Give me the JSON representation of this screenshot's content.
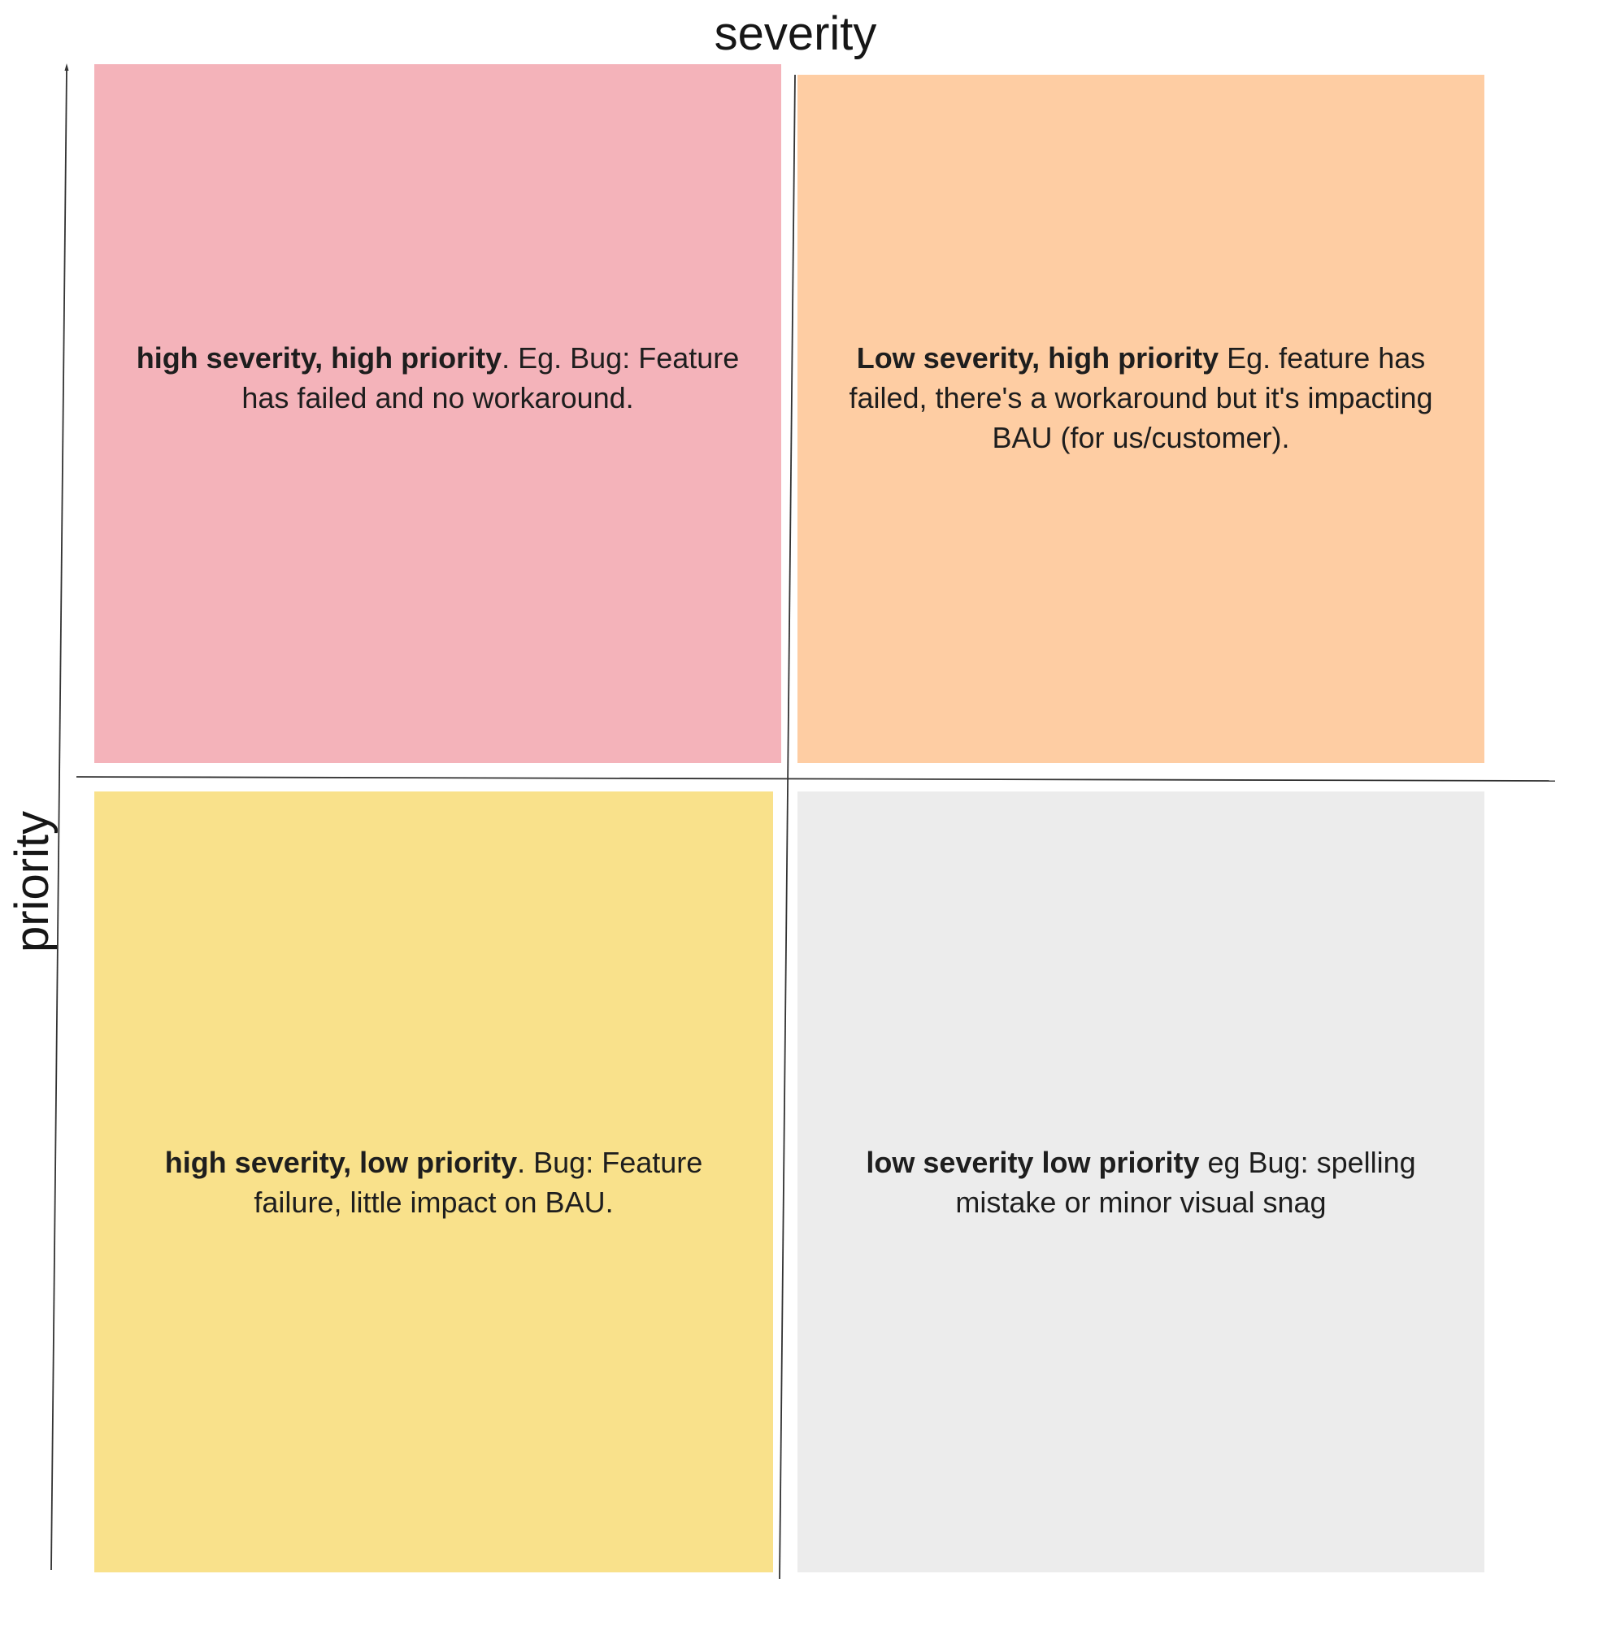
{
  "axes": {
    "x_label": "severity",
    "y_label": "priority"
  },
  "quadrants": [
    {
      "id": "high-severity-high-priority",
      "color": "#f4b3ba",
      "title": "high severity, high priority",
      "body": ". Eg. Bug: Feature has failed and no workaround."
    },
    {
      "id": "low-severity-high-priority",
      "color": "#fecda3",
      "title": "Low severity, high priority",
      "body": " Eg. feature has failed, there's a workaround but it's impacting BAU (for us/customer)."
    },
    {
      "id": "high-severity-low-priority",
      "color": "#f9e18b",
      "title": "high severity, low priority",
      "body": ". Bug: Feature failure, little impact on BAU."
    },
    {
      "id": "low-severity-low-priority",
      "color": "#ececec",
      "title": "low severity low priority",
      "body": " eg Bug: spelling mistake or minor visual snag"
    }
  ]
}
